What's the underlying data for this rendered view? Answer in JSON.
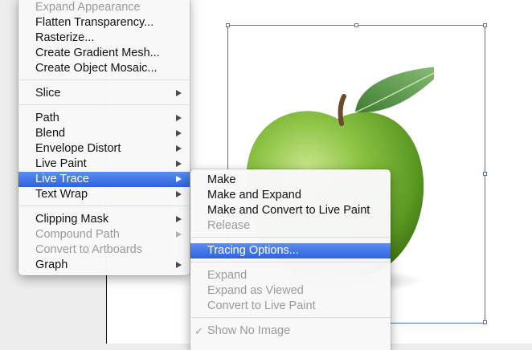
{
  "main_menu": {
    "items": [
      {
        "label": "Expand Appearance",
        "disabled": true,
        "submenu": false
      },
      {
        "label": "Flatten Transparency...",
        "disabled": false,
        "submenu": false
      },
      {
        "label": "Rasterize...",
        "disabled": false,
        "submenu": false
      },
      {
        "label": "Create Gradient Mesh...",
        "disabled": false,
        "submenu": false
      },
      {
        "label": "Create Object Mosaic...",
        "disabled": false,
        "submenu": false
      },
      {
        "label": "Slice",
        "disabled": false,
        "submenu": true
      },
      {
        "label": "Path",
        "disabled": false,
        "submenu": true
      },
      {
        "label": "Blend",
        "disabled": false,
        "submenu": true
      },
      {
        "label": "Envelope Distort",
        "disabled": false,
        "submenu": true
      },
      {
        "label": "Live Paint",
        "disabled": false,
        "submenu": true
      },
      {
        "label": "Live Trace",
        "disabled": false,
        "submenu": true,
        "active": true
      },
      {
        "label": "Text Wrap",
        "disabled": false,
        "submenu": true
      },
      {
        "label": "Clipping Mask",
        "disabled": false,
        "submenu": true
      },
      {
        "label": "Compound Path",
        "disabled": true,
        "submenu": true
      },
      {
        "label": "Convert to Artboards",
        "disabled": true,
        "submenu": false
      },
      {
        "label": "Graph",
        "disabled": false,
        "submenu": true
      }
    ]
  },
  "live_trace_submenu": {
    "items": [
      {
        "label": "Make",
        "disabled": false
      },
      {
        "label": "Make and Expand",
        "disabled": false
      },
      {
        "label": "Make and Convert to Live Paint",
        "disabled": false
      },
      {
        "label": "Release",
        "disabled": true
      },
      {
        "label": "Tracing Options...",
        "disabled": false,
        "active": true
      },
      {
        "label": "Expand",
        "disabled": true
      },
      {
        "label": "Expand as Viewed",
        "disabled": true
      },
      {
        "label": "Convert to Live Paint",
        "disabled": true
      },
      {
        "label": "Show No Image",
        "disabled": true,
        "checked": true
      }
    ]
  },
  "colors": {
    "highlight": "#2e63e0",
    "selection_box": "#4a6fd8",
    "apple_green": "#7db43a",
    "leaf_green": "#4f8f3d"
  },
  "canvas": {
    "image": "green-apple-with-leaf"
  }
}
